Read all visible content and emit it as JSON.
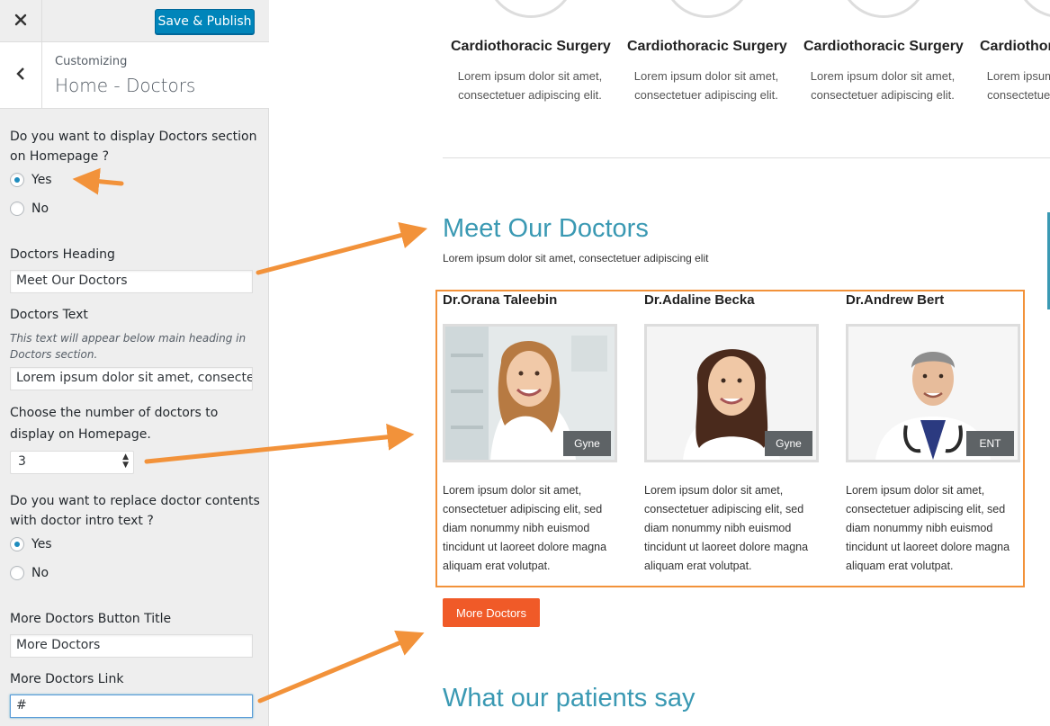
{
  "sidebar": {
    "publish_label": "Save & Publish",
    "customizing_label": "Customizing",
    "section_title": "Home - Doctors",
    "display_question": "Do you want to display Doctors section on Homepage ?",
    "display_yes": "Yes",
    "display_no": "No",
    "display_selected": "Yes",
    "heading_label": "Doctors Heading",
    "heading_value": "Meet Our Doctors",
    "text_label": "Doctors Text",
    "text_desc": "This text will appear below main heading in Doctors section.",
    "text_value": "Lorem ipsum dolor sit amet, consectetu",
    "count_label": "Choose the number of doctors to display on Homepage.",
    "count_value": "3",
    "replace_question": "Do you want to replace doctor contents with doctor intro text ?",
    "replace_yes": "Yes",
    "replace_no": "No",
    "replace_selected": "Yes",
    "button_title_label": "More Doctors Button Title",
    "button_title_value": "More Doctors",
    "link_label": "More Doctors Link",
    "link_value": "#"
  },
  "preview": {
    "services": [
      {
        "title": "Cardiothoracic Surgery",
        "text1": "Lorem ipsum dolor sit amet,",
        "text2": "consectetuer adipiscing elit."
      },
      {
        "title": "Cardiothoracic Surgery",
        "text1": "Lorem ipsum dolor sit amet,",
        "text2": "consectetuer adipiscing elit."
      },
      {
        "title": "Cardiothoracic Surgery",
        "text1": "Lorem ipsum dolor sit amet,",
        "text2": "consectetuer adipiscing elit."
      },
      {
        "title": "Cardiothoracic Surgery",
        "text1": "Lorem ipsum dolor sit amet,",
        "text2": "consectetuer adipiscing elit."
      }
    ],
    "doctors_heading": "Meet Our Doctors",
    "doctors_subtext": "Lorem ipsum dolor sit amet, consectetuer adipiscing elit",
    "doctors": [
      {
        "name": "Dr.Orana Taleebin",
        "badge": "Gyne",
        "bio": "Lorem ipsum dolor sit amet, consectetuer adipiscing elit, sed diam nonummy nibh euismod tincidunt ut laoreet dolore magna aliquam erat volutpat."
      },
      {
        "name": "Dr.Adaline Becka",
        "badge": "Gyne",
        "bio": "Lorem ipsum dolor sit amet, consectetuer adipiscing elit, sed diam nonummy nibh euismod tincidunt ut laoreet dolore magna aliquam erat volutpat."
      },
      {
        "name": "Dr.Andrew Bert",
        "badge": "ENT",
        "bio": "Lorem ipsum dolor sit amet, consectetuer adipiscing elit, sed diam nonummy nibh euismod tincidunt ut laoreet dolore magna aliquam erat volutpat."
      }
    ],
    "more_button": "More Doctors",
    "testimonials_heading": "What our patients say"
  },
  "icons": {
    "close": "close-icon",
    "back": "chevron-left-icon",
    "select_arrows": "select-arrows-icon"
  },
  "colors": {
    "accent_blue": "#0085ba",
    "teal_heading": "#3a99b3",
    "orange_button": "#f05a28",
    "annotation_orange": "#f2923a",
    "badge_gray": "#5e6366"
  }
}
